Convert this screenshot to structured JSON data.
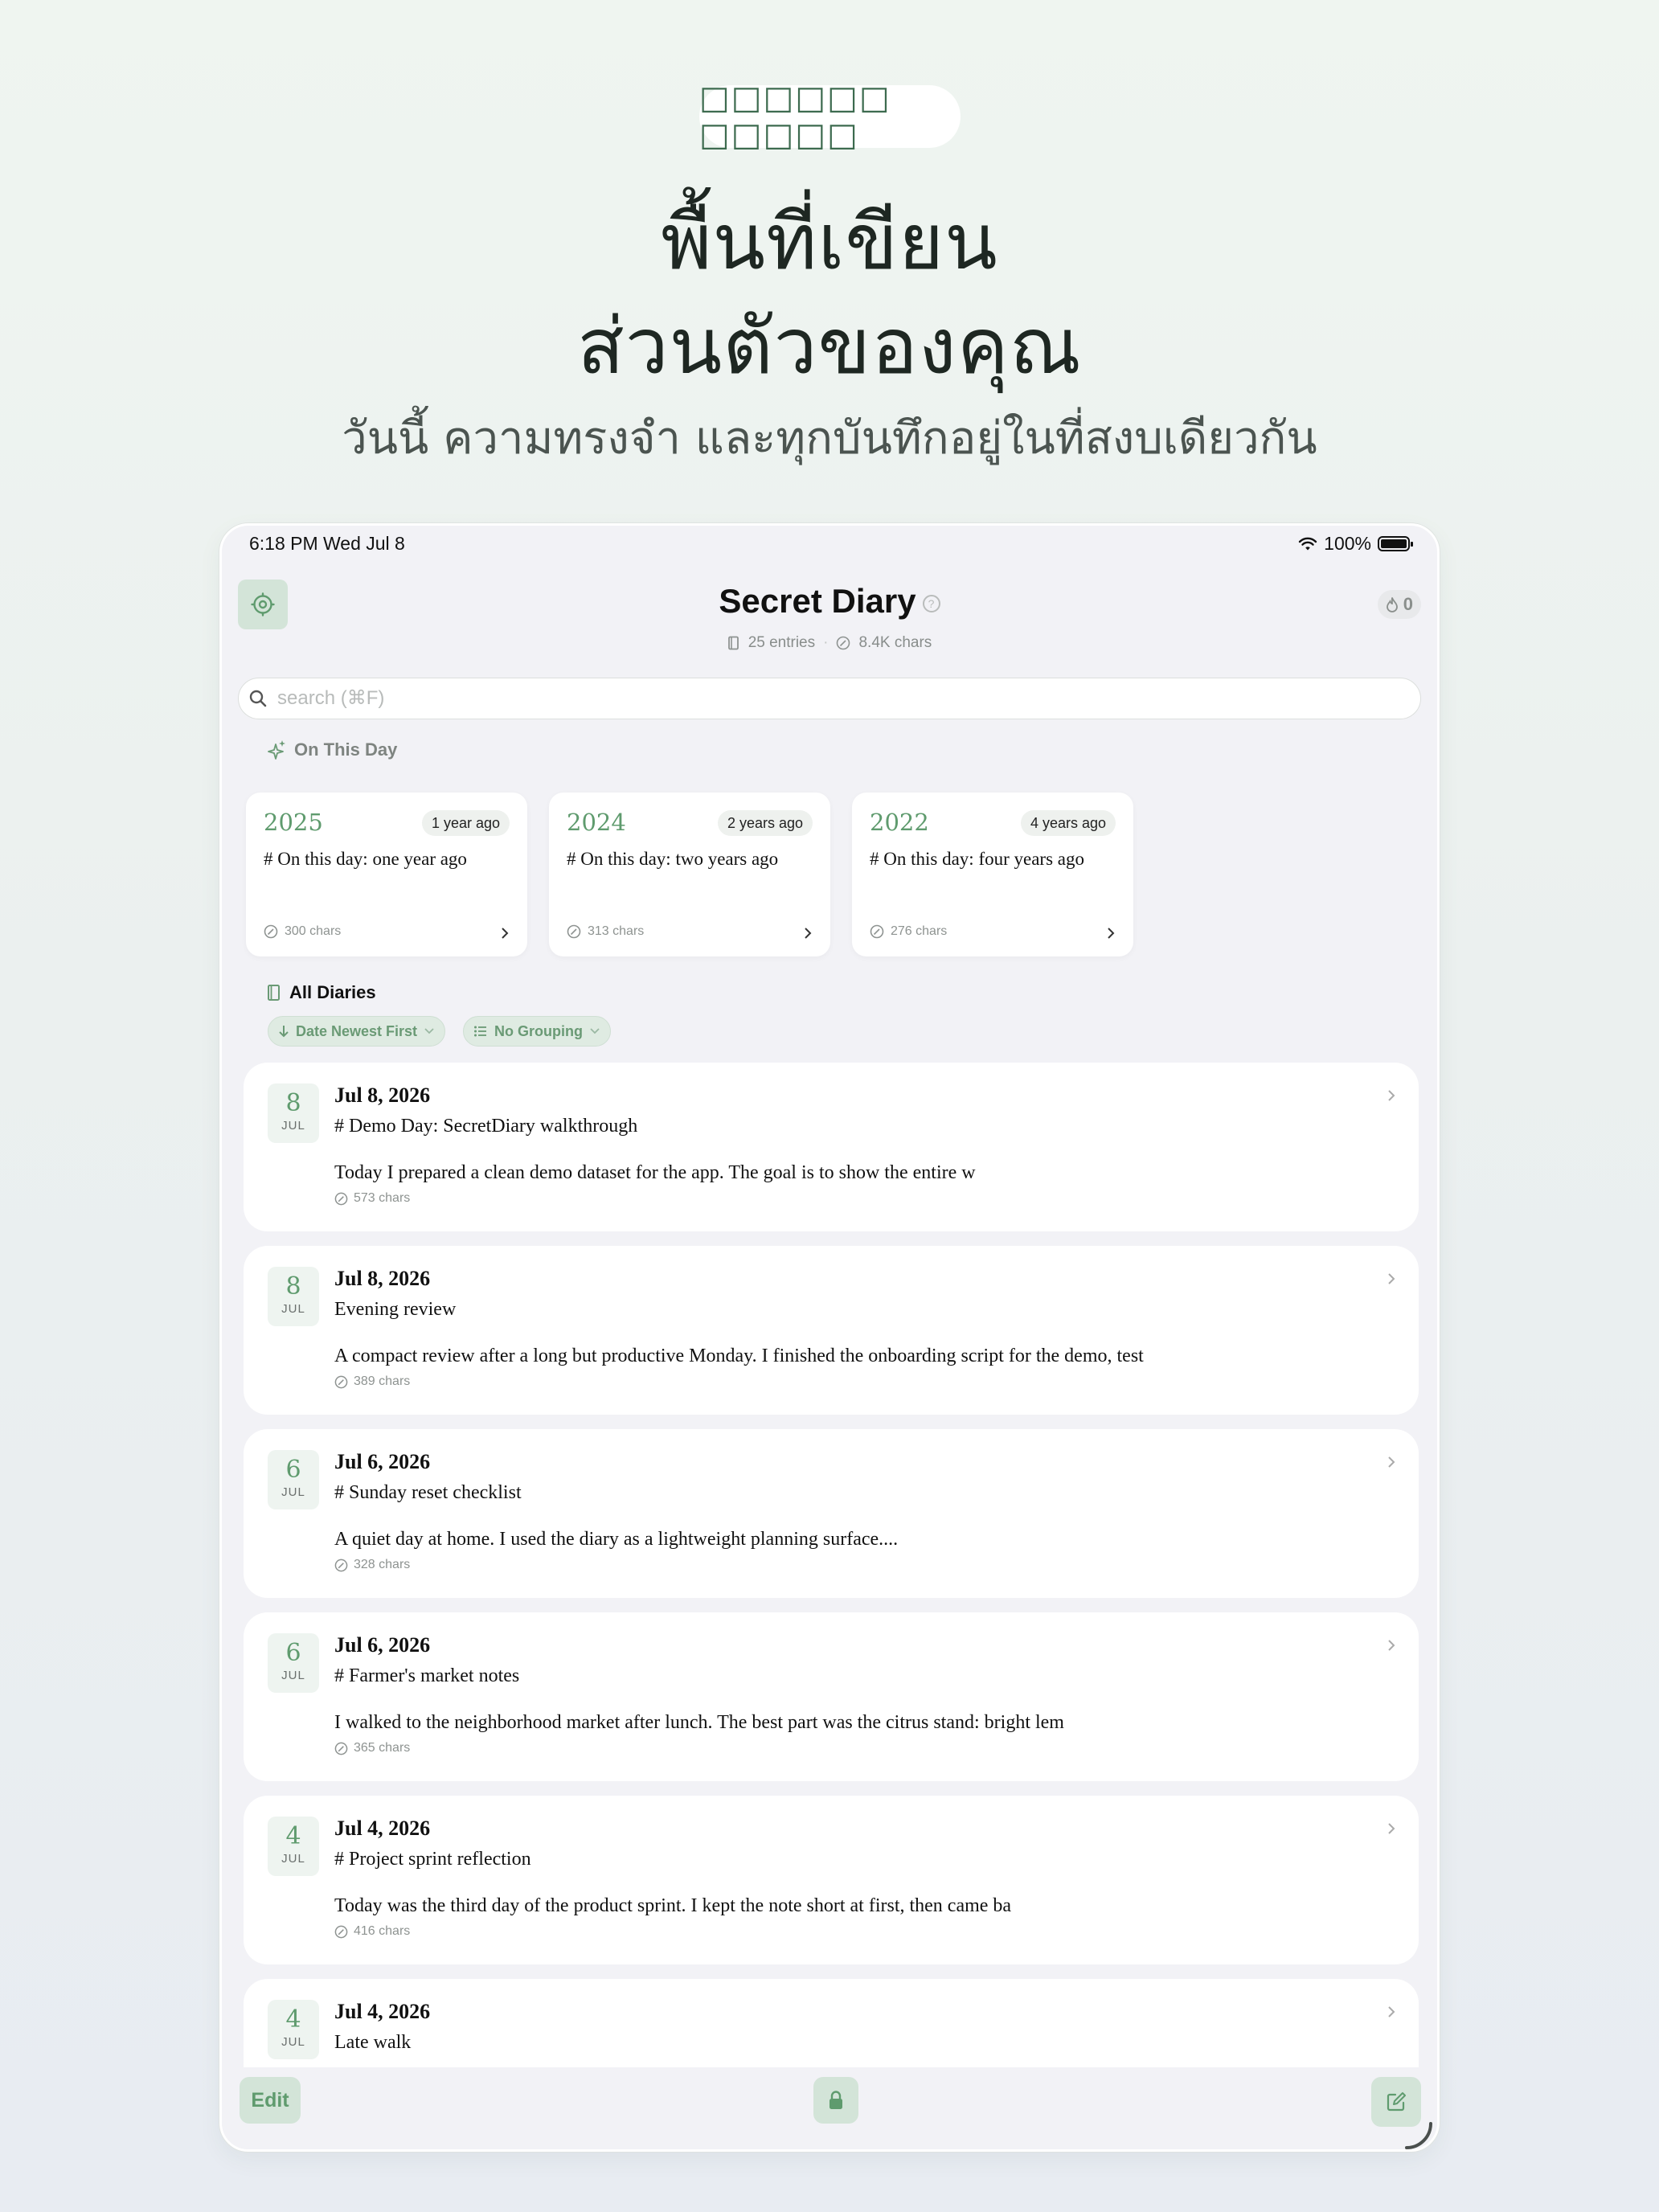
{
  "banner": {
    "pill_text": "□□□□□□ □□□□□",
    "headline_line1": "พื้นที่เขียน",
    "headline_line2": "ส่วนตัวของคุณ",
    "subline": "วันนี้ ความทรงจำ และทุกบันทึกอยู่ในที่สงบเดียวกัน"
  },
  "status_bar": {
    "time": "6:18 PM",
    "date": "Wed Jul 8",
    "battery": "100%",
    "battery_level": 1.0
  },
  "header": {
    "title": "Secret Diary",
    "help_glyph": "?",
    "entries": "25 entries",
    "chars": "8.4K chars",
    "streak_count": "0"
  },
  "search": {
    "placeholder": "search (⌘F)"
  },
  "on_this_day": {
    "label": "On This Day",
    "cards": [
      {
        "year": "2025",
        "ago": "1 year ago",
        "text": "# On this day: one year ago",
        "chars": "300 chars"
      },
      {
        "year": "2024",
        "ago": "2 years ago",
        "text": "# On this day: two years ago",
        "chars": "313 chars"
      },
      {
        "year": "2022",
        "ago": "4 years ago",
        "text": "# On this day: four years ago",
        "chars": "276 chars"
      }
    ]
  },
  "all_diaries": {
    "label": "All Diaries",
    "sort_chip": "Date Newest First",
    "group_chip": "No Grouping"
  },
  "entries": [
    {
      "day": "8",
      "month": "JUL",
      "date": "Jul 8, 2026",
      "title": "# Demo Day: SecretDiary walkthrough",
      "body": "Today I prepared a clean demo dataset for the app. The goal is to show the entire w",
      "chars": "573 chars"
    },
    {
      "day": "8",
      "month": "JUL",
      "date": "Jul 8, 2026",
      "title": "Evening review",
      "body": "A compact review after a long but productive Monday. I finished the onboarding script for the demo, test",
      "chars": "389 chars"
    },
    {
      "day": "6",
      "month": "JUL",
      "date": "Jul 6, 2026",
      "title": "# Sunday reset checklist",
      "body": "A quiet day at home. I used the diary as a lightweight planning surface....",
      "chars": "328 chars"
    },
    {
      "day": "6",
      "month": "JUL",
      "date": "Jul 6, 2026",
      "title": "# Farmer's market notes",
      "body": "I walked to the neighborhood market after lunch. The best part was the citrus stand: bright lem",
      "chars": "365 chars"
    },
    {
      "day": "4",
      "month": "JUL",
      "date": "Jul 4, 2026",
      "title": "# Project sprint reflection",
      "body": "Today was the third day of the product sprint. I kept the note short at first, then came ba",
      "chars": "416 chars"
    },
    {
      "day": "4",
      "month": "JUL",
      "date": "Jul 4, 2026",
      "title": "Late walk",
      "body": "",
      "chars": ""
    }
  ],
  "toolbar": {
    "edit_label": "Edit"
  },
  "colors": {
    "accent_green": "#5f9b6e",
    "button_bg": "#d3e4d8",
    "app_bg": "#f2f2f6"
  }
}
